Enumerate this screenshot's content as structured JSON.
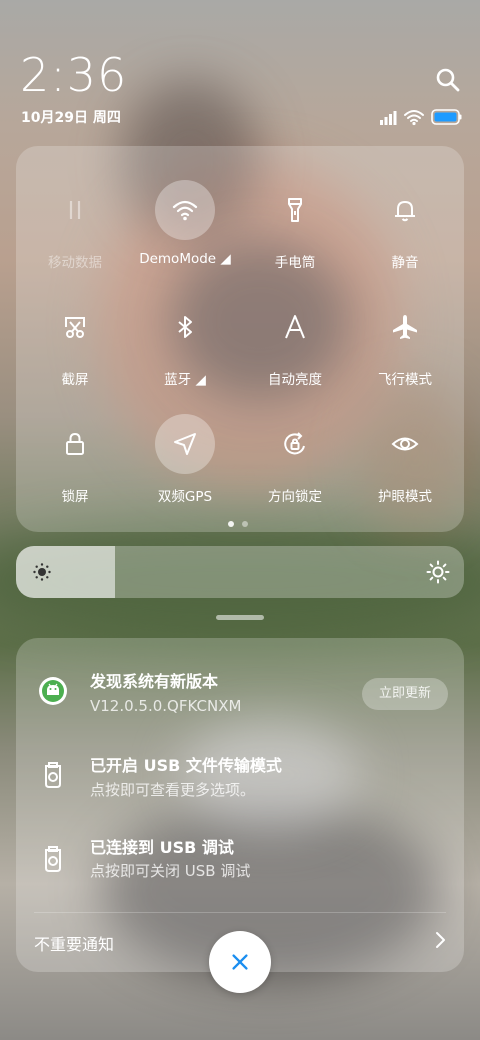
{
  "status": {
    "time": "2:36",
    "date": "10月29日 周四",
    "icons": [
      "signal-icon",
      "wifi-icon",
      "battery-icon"
    ]
  },
  "quick_settings": {
    "tiles": [
      {
        "id": "mobile-data",
        "label": "移动数据",
        "icon": "mobile-data-icon",
        "state": "disabled"
      },
      {
        "id": "wifi",
        "label": "DemoMode ◢",
        "icon": "wifi-icon",
        "state": "on"
      },
      {
        "id": "flashlight",
        "label": "手电筒",
        "icon": "flashlight-icon",
        "state": "off"
      },
      {
        "id": "silent",
        "label": "静音",
        "icon": "bell-icon",
        "state": "off"
      },
      {
        "id": "screenshot",
        "label": "截屏",
        "icon": "scissors-icon",
        "state": "off"
      },
      {
        "id": "bluetooth",
        "label": "蓝牙 ◢",
        "icon": "bluetooth-icon",
        "state": "off"
      },
      {
        "id": "auto-brightness",
        "label": "自动亮度",
        "icon": "auto-brightness-icon",
        "state": "off"
      },
      {
        "id": "airplane",
        "label": "飞行模式",
        "icon": "airplane-icon",
        "state": "off"
      },
      {
        "id": "lock",
        "label": "锁屏",
        "icon": "lock-icon",
        "state": "off"
      },
      {
        "id": "gps",
        "label": "双频GPS",
        "icon": "location-icon",
        "state": "on"
      },
      {
        "id": "rotation-lock",
        "label": "方向锁定",
        "icon": "rotation-lock-icon",
        "state": "off"
      },
      {
        "id": "eye-care",
        "label": "护眼模式",
        "icon": "eye-icon",
        "state": "off"
      }
    ],
    "pages": 2,
    "current_page": 1
  },
  "brightness": {
    "level": 0.22
  },
  "notifications": [
    {
      "icon": "android-update-icon",
      "title": "发现系统有新版本",
      "text": "V12.0.5.0.QFKCNXM",
      "action": "立即更新"
    },
    {
      "icon": "usb-icon",
      "title": "已开启 USB 文件传输模式",
      "text": "点按即可查看更多选项。"
    },
    {
      "icon": "usb-icon",
      "title": "已连接到 USB 调试",
      "text": "点按即可关闭 USB 调试"
    }
  ],
  "unimportant_label": "不重要通知",
  "colors": {
    "clear_button_icon": "#1a8ef0",
    "update_icon_green": "#4caf50"
  }
}
